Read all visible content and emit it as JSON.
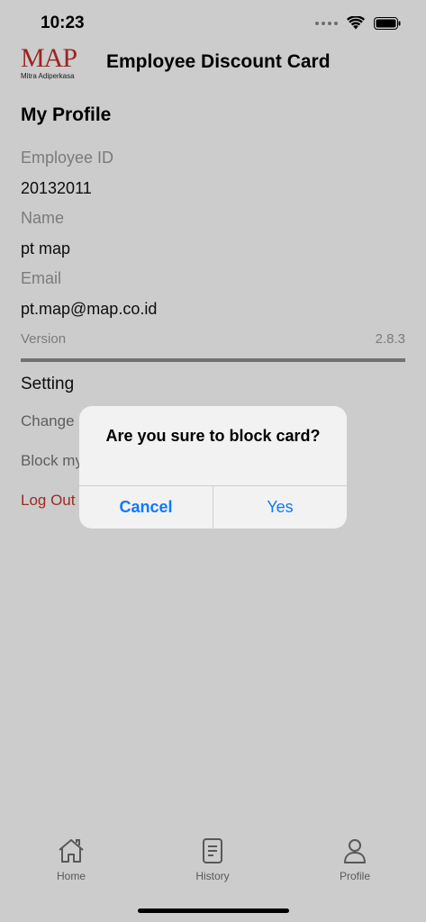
{
  "status_bar": {
    "time": "10:23"
  },
  "header": {
    "logo_text": "MAP",
    "logo_subtext": "Mitra Adiperkasa",
    "title": "Employee Discount Card"
  },
  "profile": {
    "section_title": "My Profile",
    "fields": [
      {
        "label": "Employee ID",
        "value": "20132011"
      },
      {
        "label": "Name",
        "value": "pt map"
      },
      {
        "label": "Email",
        "value": "pt.map@map.co.id"
      }
    ],
    "version_label": "Version",
    "version_value": "2.8.3"
  },
  "setting": {
    "title": "Setting",
    "items": [
      {
        "label": "Change P"
      },
      {
        "label": "Block my"
      }
    ],
    "logout_label": "Log Out"
  },
  "tab_bar": {
    "items": [
      {
        "label": "Home",
        "icon": "home-icon"
      },
      {
        "label": "History",
        "icon": "history-icon"
      },
      {
        "label": "Profile",
        "icon": "profile-icon"
      }
    ]
  },
  "alert": {
    "message": "Are you sure to block card?",
    "cancel_label": "Cancel",
    "confirm_label": "Yes"
  },
  "colors": {
    "accent": "#0a7aff",
    "logout": "#c0392b",
    "brand": "#c0302a"
  }
}
